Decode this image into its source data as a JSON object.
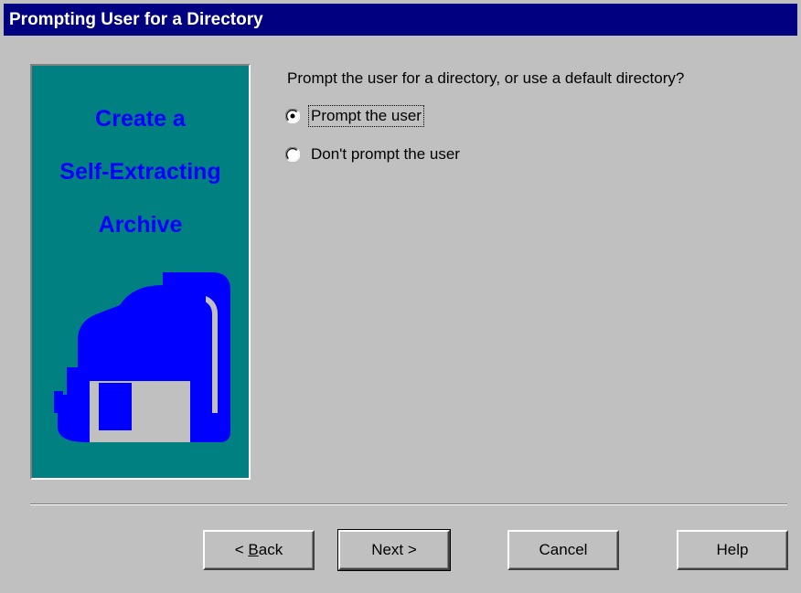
{
  "window": {
    "title": "Prompting User for a Directory"
  },
  "banner": {
    "line1": "Create a",
    "line2": "Self-Extracting",
    "line3": "Archive",
    "icon": "floppy-disk-icon",
    "bg_color": "#008080",
    "text_color": "#0000ff"
  },
  "main": {
    "question": "Prompt the user for a directory, or use a default directory?",
    "options": [
      {
        "label": "Prompt the user",
        "selected": true
      },
      {
        "label": "Don't prompt the user",
        "selected": false
      }
    ]
  },
  "buttons": {
    "back_prefix": "< ",
    "back_mnemonic": "B",
    "back_rest": "ack",
    "next": "Next >",
    "cancel": "Cancel",
    "help": "Help"
  },
  "colors": {
    "titlebar": "#000080",
    "dialog": "#c0c0c0"
  }
}
